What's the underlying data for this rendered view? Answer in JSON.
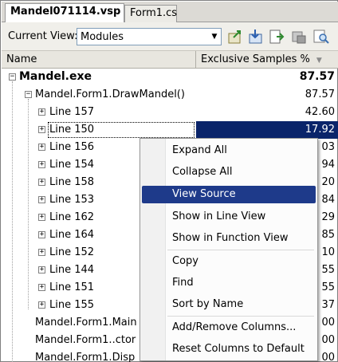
{
  "tabs": [
    {
      "label": "Mandel071114.vsp",
      "active": true
    },
    {
      "label": "Form1.cs",
      "active": false
    }
  ],
  "toolbar": {
    "current_view_label": "Current View:",
    "current_view_value": "Modules",
    "icons": [
      "export-icon",
      "import-icon",
      "report-icon",
      "filter-icon",
      "search-icon"
    ]
  },
  "grid": {
    "columns": [
      "Name",
      "Exclusive Samples %"
    ],
    "rows": [
      {
        "name": "Mandel.exe",
        "value": "87.57",
        "expander": "−"
      },
      {
        "name": "Mandel.Form1.DrawMandel()",
        "value": "87.57",
        "expander": "−"
      },
      {
        "name": "Line 157",
        "value": "42.60",
        "expander": "+"
      },
      {
        "name": "Line 150",
        "value": "17.92",
        "expander": "+",
        "selected": true
      },
      {
        "name": "Line 156",
        "value": "03",
        "expander": "+"
      },
      {
        "name": "Line 154",
        "value": "94",
        "expander": "+"
      },
      {
        "name": "Line 158",
        "value": "20",
        "expander": "+"
      },
      {
        "name": "Line 153",
        "value": "84",
        "expander": "+"
      },
      {
        "name": "Line 162",
        "value": "29",
        "expander": "+"
      },
      {
        "name": "Line 164",
        "value": "85",
        "expander": "+"
      },
      {
        "name": "Line 152",
        "value": "10",
        "expander": "+"
      },
      {
        "name": "Line 144",
        "value": "55",
        "expander": "+"
      },
      {
        "name": "Line 151",
        "value": "55",
        "expander": "+"
      },
      {
        "name": "Line 155",
        "value": "37",
        "expander": "+"
      },
      {
        "name": "Mandel.Form1.Main",
        "value": "00"
      },
      {
        "name": "Mandel.Form1..ctor",
        "value": "00"
      },
      {
        "name": "Mandel.Form1.Disp",
        "value": "00"
      }
    ]
  },
  "context_menu": {
    "items": [
      "Expand All",
      "Collapse All",
      "View Source",
      "Show in Line View",
      "Show in Function View",
      "Copy",
      "Find",
      "Sort by Name",
      "Add/Remove Columns...",
      "Reset Columns to Default"
    ],
    "highlighted": "View Source"
  }
}
